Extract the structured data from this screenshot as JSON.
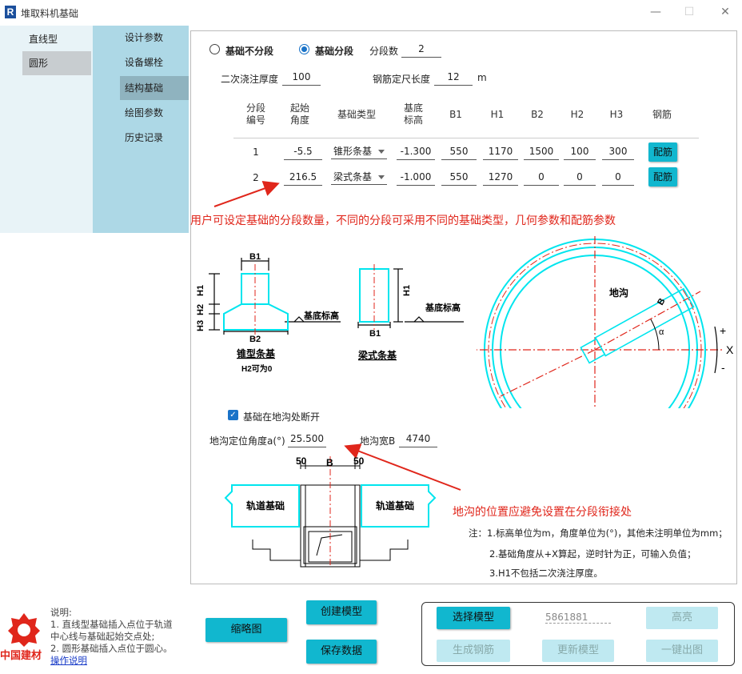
{
  "window": {
    "title": "堆取料机基础",
    "logo_letter": "R"
  },
  "left_nav": {
    "items": [
      {
        "label": "直线型"
      },
      {
        "label": "圆形"
      }
    ],
    "selected": "圆形"
  },
  "sub_nav": {
    "items": [
      {
        "label": "设计参数"
      },
      {
        "label": "设备螺栓"
      },
      {
        "label": "结构基础"
      },
      {
        "label": "绘图参数"
      },
      {
        "label": "历史记录"
      }
    ],
    "selected": "结构基础"
  },
  "form": {
    "radio_no_segment": "基础不分段",
    "radio_segment": "基础分段",
    "segment_count_label": "分段数",
    "segment_count": "2",
    "grout_label": "二次浇注厚度",
    "grout_value": "100",
    "rebar_len_label": "钢筋定尺长度",
    "rebar_len_value": "12",
    "rebar_len_unit": "m"
  },
  "table": {
    "headers": [
      "分段\n编号",
      "起始\n角度",
      "基础类型",
      "基底\n标高",
      "B1",
      "H1",
      "B2",
      "H2",
      "H3",
      "钢筋"
    ],
    "rows": [
      {
        "no": "1",
        "angle": "-5.5",
        "type": "锥形条基",
        "elev": "-1.300",
        "b1": "550",
        "h1": "1170",
        "b2": "1500",
        "h2": "100",
        "h3": "300",
        "btn": "配筋"
      },
      {
        "no": "2",
        "angle": "216.5",
        "type": "梁式条基",
        "elev": "-1.000",
        "b1": "550",
        "h1": "1270",
        "b2": "0",
        "h2": "0",
        "h3": "0",
        "btn": "配筋"
      }
    ]
  },
  "annotation_top": "用户可设定基础的分段数量，不同的分段可采用不同的基础类型，几何参数和配筋参数",
  "diagram_cone": {
    "b1": "B1",
    "b2": "B2",
    "h1": "H1",
    "h2": "H2",
    "h3": "H3",
    "elev": "基底标高",
    "caption": "锥型条基",
    "note": "H2可为0"
  },
  "diagram_beam": {
    "b1": "B1",
    "h1": "H1",
    "elev": "基底标高",
    "caption": "梁式条基"
  },
  "diagram_circle": {
    "trench": "地沟",
    "b": "B",
    "a": "α",
    "plus": "+",
    "minus": "-",
    "x": "X"
  },
  "trench": {
    "checkbox_label": "基础在地沟处断开",
    "angle_label": "地沟定位角度a(°)",
    "angle_value": "25.500",
    "width_label": "地沟宽B",
    "width_value": "4740"
  },
  "diagram_trench": {
    "dim_left": "50",
    "dim_b": "B",
    "dim_right": "50",
    "left_label": "轨道基础",
    "right_label": "轨道基础"
  },
  "annotation_bottom": "地沟的位置应避免设置在分段衔接处",
  "notes": {
    "line1": "注：1.标高单位为m，角度单位为(°)，其他未注明单位为mm；",
    "line2": "2.基础角度从+X算起，逆时针为正，可输入负值；",
    "line3": "3.H1不包括二次浇注厚度。"
  },
  "footer": {
    "brand": "中国建材",
    "desc_title": "说明:",
    "desc1": "1. 直线型基础插入点位于轨道",
    "desc2": "中心线与基础起始交点处;",
    "desc3": "2. 圆形基础插入点位于圆心。",
    "help_link": "操作说明",
    "thumb_btn": "缩略图",
    "create_btn": "创建模型",
    "save_btn": "保存数据",
    "select_btn": "选择模型",
    "model_id": "5861881",
    "highlight_btn": "高亮",
    "gen_rebar_btn": "生成钢筋",
    "update_btn": "更新模型",
    "export_btn": "一键出图"
  },
  "colors": {
    "accent": "#11b7cf",
    "nav_bg": "#add8e6",
    "annotation": "#e0261b",
    "drawing_cyan": "#00e5ee"
  }
}
